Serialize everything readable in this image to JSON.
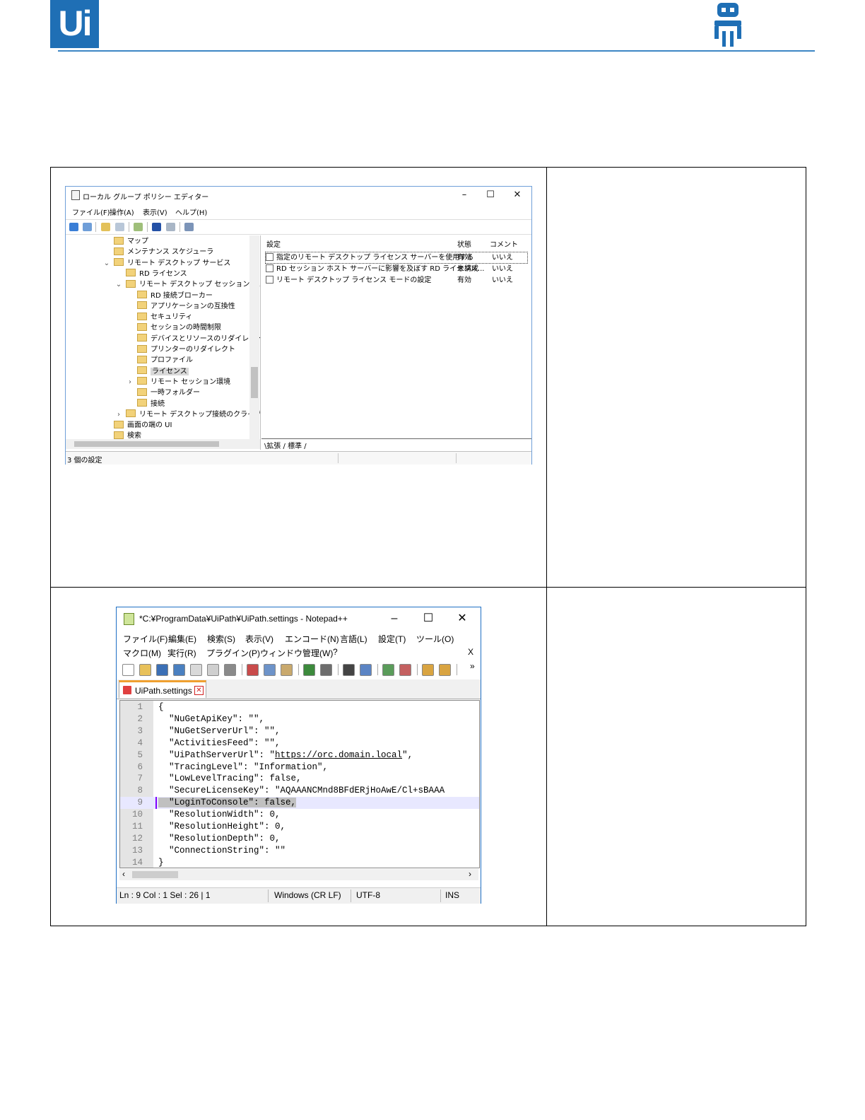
{
  "header": {
    "logo_text": "Ui"
  },
  "gpe": {
    "title": "ローカル グループ ポリシー エディター",
    "menu": [
      "ファイル(F)",
      "操作(A)",
      "表示(V)",
      "ヘルプ(H)"
    ],
    "tree": [
      {
        "label": "マップ",
        "depth": 0
      },
      {
        "label": "メンテナンス スケジューラ",
        "depth": 0
      },
      {
        "label": "リモート デスクトップ サービス",
        "depth": 0,
        "expander": "⌄"
      },
      {
        "label": "RD ライセンス",
        "depth": 1
      },
      {
        "label": "リモート デスクトップ セッション ホスト",
        "depth": 1,
        "expander": "⌄"
      },
      {
        "label": "RD 接続ブローカー",
        "depth": 2
      },
      {
        "label": "アプリケーションの互換性",
        "depth": 2
      },
      {
        "label": "セキュリティ",
        "depth": 2
      },
      {
        "label": "セッションの時間制限",
        "depth": 2
      },
      {
        "label": "デバイスとリソースのリダイレクト",
        "depth": 2
      },
      {
        "label": "プリンターのリダイレクト",
        "depth": 2
      },
      {
        "label": "プロファイル",
        "depth": 2
      },
      {
        "label": "ライセンス",
        "depth": 2,
        "selected": true
      },
      {
        "label": "リモート セッション環境",
        "depth": 2,
        "expander": "›"
      },
      {
        "label": "一時フォルダー",
        "depth": 2
      },
      {
        "label": "接続",
        "depth": 2
      },
      {
        "label": "リモート デスクトップ接続のクライアント",
        "depth": 1,
        "expander": "›"
      },
      {
        "label": "画面の端の UI",
        "depth": 0
      },
      {
        "label": "検索",
        "depth": 0
      }
    ],
    "list_headers": {
      "setting": "設定",
      "state": "状態",
      "comment": "コメント"
    },
    "rows": [
      {
        "setting": "指定のリモート デスクトップ ライセンス サーバーを使用する",
        "state": "有効",
        "comment": "いいえ"
      },
      {
        "setting": "RD セッション ホスト サーバーに影響を及ぼす RD ライセンス...",
        "state": "未構成",
        "comment": "いいえ"
      },
      {
        "setting": "リモート デスクトップ ライセンス モードの設定",
        "state": "有効",
        "comment": "いいえ"
      }
    ],
    "tabs": "\\拡張 / 標準 /",
    "status": "3 個の設定"
  },
  "npp": {
    "title": "*C:¥ProgramData¥UiPath¥UiPath.settings - Notepad++",
    "menu1": [
      "ファイル(F)",
      "編集(E)",
      "検索(S)",
      "表示(V)",
      "エンコード(N)",
      "言語(L)",
      "設定(T)",
      "ツール(O)"
    ],
    "menu2": [
      "マクロ(M)",
      "実行(R)",
      "プラグイン(P)",
      "ウィンドウ管理(W)",
      "?"
    ],
    "menu_close": "X",
    "toolbar_overflow": "»",
    "tab_label": "UiPath.settings",
    "lines": [
      {
        "n": "1",
        "text": "{"
      },
      {
        "n": "2",
        "text": "  \"NuGetApiKey\": \"\","
      },
      {
        "n": "3",
        "text": "  \"NuGetServerUrl\": \"\","
      },
      {
        "n": "4",
        "text": "  \"ActivitiesFeed\": \"\","
      },
      {
        "n": "5",
        "text": "  \"UiPathServerUrl\": \"https://orc.domain.local\","
      },
      {
        "n": "6",
        "text": "  \"TracingLevel\": \"Information\","
      },
      {
        "n": "7",
        "text": "  \"LowLevelTracing\": false,"
      },
      {
        "n": "8",
        "text": "  \"SecureLicenseKey\": \"AQAAANCMnd8BFdERjHoAwE/Cl+sBAAA"
      },
      {
        "n": "9",
        "text": "  \"LoginToConsole\": false,"
      },
      {
        "n": "10",
        "text": "  \"ResolutionWidth\": 0,"
      },
      {
        "n": "11",
        "text": "  \"ResolutionHeight\": 0,"
      },
      {
        "n": "12",
        "text": "  \"ResolutionDepth\": 0,"
      },
      {
        "n": "13",
        "text": "  \"ConnectionString\": \"\""
      },
      {
        "n": "14",
        "text": "}"
      }
    ],
    "status": {
      "pos": "Ln : 9    Col : 1    Sel : 26 | 1",
      "eol": "Windows (CR LF)",
      "enc": "UTF-8",
      "mode": "INS"
    }
  }
}
